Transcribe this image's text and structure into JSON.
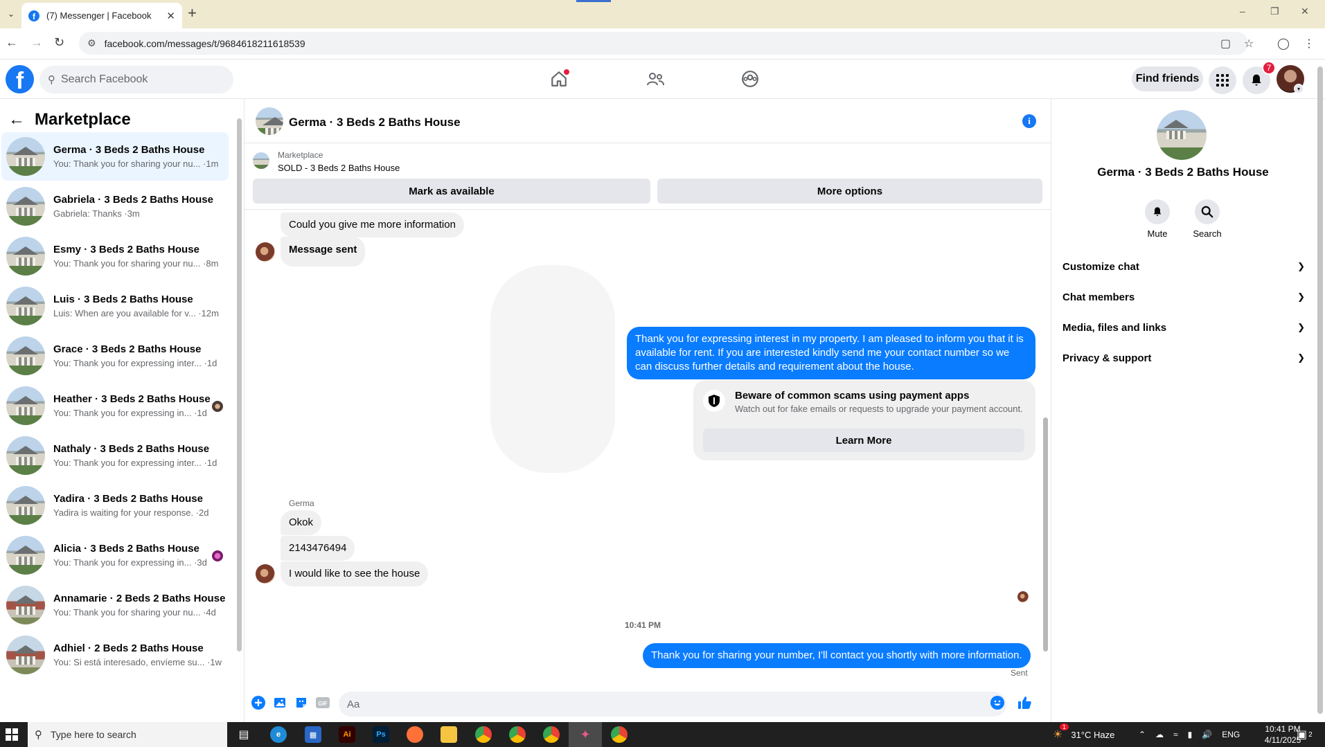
{
  "browser": {
    "tab_title": "(7) Messenger | Facebook",
    "url": "facebook.com/messages/t/9684618211618539"
  },
  "fb": {
    "search_placeholder": "Search Facebook",
    "find_friends": "Find friends",
    "notif_count": "7"
  },
  "sidebar": {
    "title": "Marketplace",
    "conversations": [
      {
        "name": "Germa · 3 Beds 2 Baths House",
        "preview": "You: Thank you for sharing your nu... ·1m",
        "active": true
      },
      {
        "name": "Gabriela · 3 Beds 2 Baths House",
        "preview": "Gabriela: Thanks ·3m"
      },
      {
        "name": "Esmy · 3 Beds 2 Baths House",
        "preview": "You: Thank you for sharing your nu... ·8m"
      },
      {
        "name": "Luis · 3 Beds 2 Baths House",
        "preview": "Luis: When are you available for v... ·12m"
      },
      {
        "name": "Grace · 3 Beds 2 Baths House",
        "preview": "You: Thank you for expressing inter... ·1d"
      },
      {
        "name": "Heather · 3 Beds 2 Baths House",
        "preview": "You: Thank you for expressing in... ·1d"
      },
      {
        "name": "Nathaly · 3 Beds 2 Baths House",
        "preview": "You: Thank you for expressing inter... ·1d"
      },
      {
        "name": "Yadira · 3 Beds 2 Baths House",
        "preview": "Yadira is waiting for your response. ·2d"
      },
      {
        "name": "Alicia · 3 Beds 2 Baths House",
        "preview": "You: Thank you for expressing in... ·3d"
      },
      {
        "name": "Annamarie · 2 Beds 2 Baths House",
        "preview": "You: Thank you for sharing your nu... ·4d"
      },
      {
        "name": "Adhiel · 2 Beds 2 Baths House",
        "preview": "You: Si está interesado, envíeme su... ·1w"
      }
    ]
  },
  "chat": {
    "title": "Germa · 3 Beds 2 Baths House",
    "marketplace_label": "Marketplace",
    "listing_status": "SOLD - 3 Beds 2 Baths House",
    "mark_available": "Mark as available",
    "more_options": "More options",
    "messages": {
      "m1": "Could you give me more information",
      "m2": "Message sent",
      "out1": "Thank you for expressing interest in my property. I am pleased to inform you that it is available for rent. If you are interested kindly send me your contact number so we can discuss further details and requirement about the house.",
      "sender": "Germa",
      "m3": "Okok",
      "m4": "2143476494",
      "m5": "I would like to see the house",
      "time": "10:41 PM",
      "out2": "Thank you for sharing your number, I'll contact you shortly with more information.",
      "sent": "Sent"
    },
    "scam_card": {
      "title": "Beware of common scams using payment apps",
      "subtitle": "Watch out for fake emails or requests to upgrade your payment account.",
      "button": "Learn More"
    },
    "composer_placeholder": "Aa"
  },
  "right_panel": {
    "name": "Germa · 3 Beds 2 Baths House",
    "mute": "Mute",
    "search": "Search",
    "sections": [
      "Customize chat",
      "Chat members",
      "Media, files and links",
      "Privacy & support"
    ]
  },
  "taskbar": {
    "search_placeholder": "Type here to search",
    "weather": "31°C  Haze",
    "lang": "ENG",
    "time": "10:41 PM",
    "date": "4/11/2025",
    "notif_count": "2",
    "weather_badge": "1"
  }
}
